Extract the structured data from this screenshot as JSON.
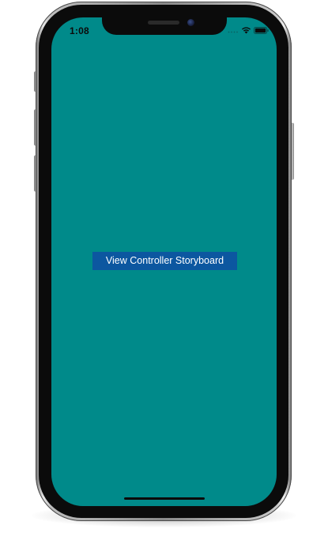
{
  "status_bar": {
    "time": "1:08",
    "signal_icon": "cellular-signal-icon",
    "wifi_icon": "wifi-icon",
    "battery_icon": "battery-icon"
  },
  "screen": {
    "background_color": "#008a8a",
    "button": {
      "label": "View Controller Storyboard",
      "background_color": "#0c57a0",
      "text_color": "#ffffff"
    }
  },
  "device": {
    "frame_color": "#0b0b0b",
    "home_indicator_icon": "home-indicator"
  }
}
